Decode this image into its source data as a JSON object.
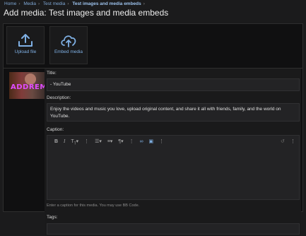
{
  "breadcrumb": {
    "items": [
      "Home",
      "Media",
      "Test media"
    ],
    "current": "Test images and media embeds",
    "separator": "›"
  },
  "page_title": "Add media: Test images and media embeds",
  "upload": {
    "upload_label": "Upload file",
    "embed_label": "Embed media"
  },
  "thumbnail": {
    "text": "ADDREM"
  },
  "form": {
    "title_label": "Title:",
    "title_value": "- YouTube",
    "description_label": "Description:",
    "description_value": "Enjoy the videos and music you love, upload original content, and share it all with friends, family, and the world on YouTube.",
    "caption_label": "Caption:",
    "caption_hint": "Enter a caption for this media. You may use BB Code.",
    "tags_label": "Tags:"
  },
  "toolbar": {
    "icons": [
      "bold-icon",
      "italic-icon",
      "text-size-icon",
      "more-icon",
      "list-icon",
      "align-icon",
      "paragraph-icon",
      "more-icon",
      "link-icon",
      "image-icon",
      "more-icon",
      "undo-icon",
      "more-icon"
    ]
  },
  "colors": {
    "accent": "#7fb0e4",
    "background": "#101011",
    "field": "#232325"
  }
}
